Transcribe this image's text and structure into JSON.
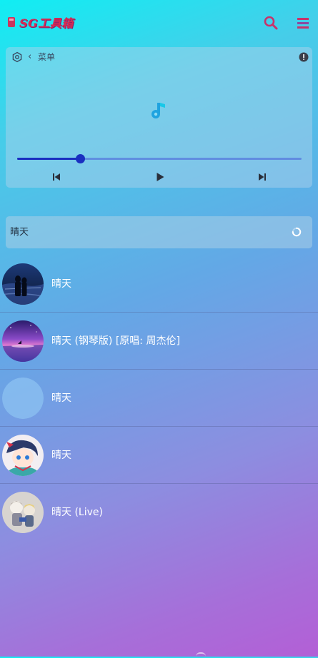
{
  "header": {
    "app_title": "SG工具箱"
  },
  "player": {
    "menu_label": "菜单",
    "progress": 0.22
  },
  "search": {
    "value": "晴天"
  },
  "songs": [
    {
      "title": "晴天",
      "avatar": "couple-seaside-night"
    },
    {
      "title": "晴天 (钢琴版) [原唱: 周杰伦]",
      "avatar": "purple-sunset-sea"
    },
    {
      "title": "晴天",
      "avatar": "blank"
    },
    {
      "title": "晴天",
      "avatar": "anime-character"
    },
    {
      "title": "晴天 (Live)",
      "avatar": "anime-figures"
    }
  ],
  "colors": {
    "accent": "#1a2fc0",
    "logo": "#d62a52",
    "music_icon": "#1fa3e0"
  }
}
